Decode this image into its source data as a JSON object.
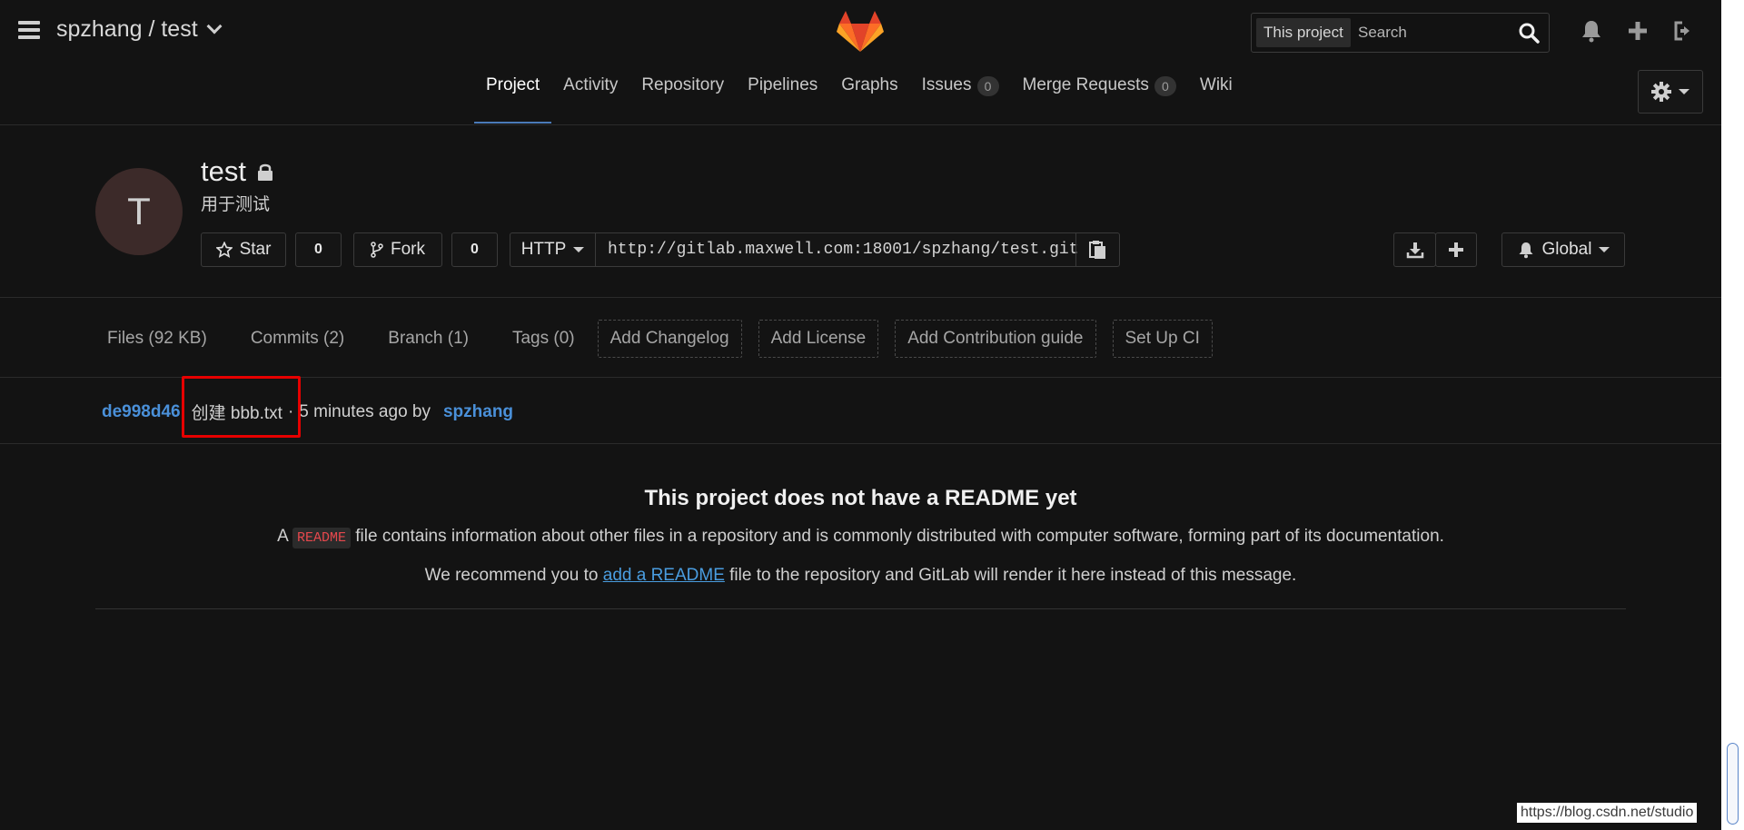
{
  "header": {
    "breadcrumb": "spzhang / test",
    "search_scope": "This project",
    "search_placeholder": "Search"
  },
  "nav": {
    "tabs": [
      {
        "label": "Project",
        "active": true
      },
      {
        "label": "Activity"
      },
      {
        "label": "Repository"
      },
      {
        "label": "Pipelines"
      },
      {
        "label": "Graphs"
      },
      {
        "label": "Issues",
        "badge": "0"
      },
      {
        "label": "Merge Requests",
        "badge": "0"
      },
      {
        "label": "Wiki"
      }
    ]
  },
  "project": {
    "avatar_letter": "T",
    "name": "test",
    "description": "用于测试",
    "star_label": "Star",
    "star_count": "0",
    "fork_label": "Fork",
    "fork_count": "0",
    "protocol": "HTTP",
    "clone_url": "http://gitlab.maxwell.com:18001/spzhang/test.git",
    "notification_level": "Global"
  },
  "stats": {
    "links": [
      "Files (92 KB)",
      "Commits (2)",
      "Branch (1)",
      "Tags (0)"
    ],
    "actions": [
      "Add Changelog",
      "Add License",
      "Add Contribution guide",
      "Set Up CI"
    ]
  },
  "last_commit": {
    "sha": "de998d46",
    "message": "创建 bbb.txt",
    "separator": "·",
    "time": "5 minutes ago by",
    "author": "spzhang"
  },
  "readme": {
    "title": "This project does not have a README yet",
    "p1_before": "A",
    "p1_code": "README",
    "p1_after": "file contains information about other files in a repository and is commonly distributed with computer software, forming part of its documentation.",
    "p2_before": "We recommend you to",
    "p2_link": "add a README",
    "p2_after": "file to the repository and GitLab will render it here instead of this message."
  },
  "watermark": "https://blog.csdn.net/studio",
  "colors": {
    "background": "#131313",
    "accent_link": "#4a90d9",
    "highlight_box": "#e60000",
    "active_tab_underline": "#4a7ab8"
  }
}
